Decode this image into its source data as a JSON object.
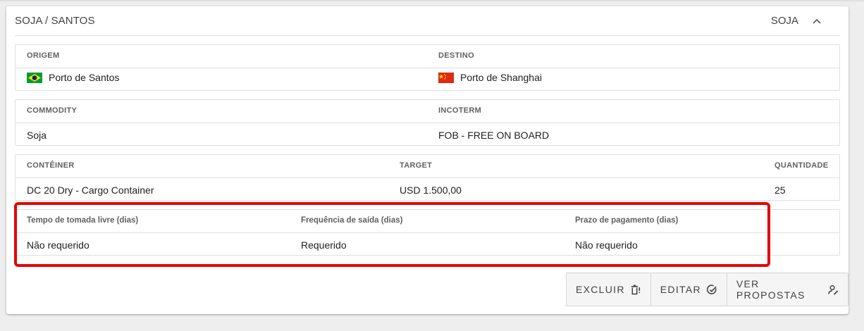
{
  "card": {
    "title": "SOJA / SANTOS",
    "tag": "SOJA"
  },
  "route": {
    "origin_label": "ORIGEM",
    "origin_value": "Porto de Santos",
    "origin_flag": "brazil-flag",
    "destination_label": "DESTINO",
    "destination_value": "Porto de Shanghai",
    "destination_flag": "china-flag"
  },
  "product": {
    "commodity_label": "COMMODITY",
    "commodity_value": "Soja",
    "incoterm_label": "INCOTERM",
    "incoterm_value": "FOB - FREE ON BOARD"
  },
  "container": {
    "container_label": "CONTÊINER",
    "container_value": "DC 20 Dry - Cargo Container",
    "target_label": "TARGET",
    "target_value": "USD 1.500,00",
    "quantity_label": "QUANTIDADE",
    "quantity_value": "25"
  },
  "terms": {
    "free_time_label": "Tempo de tomada livre (dias)",
    "free_time_value": "Não requerido",
    "frequency_label": "Frequência de saída (dias)",
    "frequency_value": "Requerido",
    "payment_label": "Prazo de pagamento (dias)",
    "payment_value": "Não requerido"
  },
  "actions": {
    "delete_label": "EXCLUIR",
    "edit_label": "EDITAR",
    "proposals_label": "VER PROPOSTAS"
  },
  "colors": {
    "highlight": "#e60000"
  }
}
